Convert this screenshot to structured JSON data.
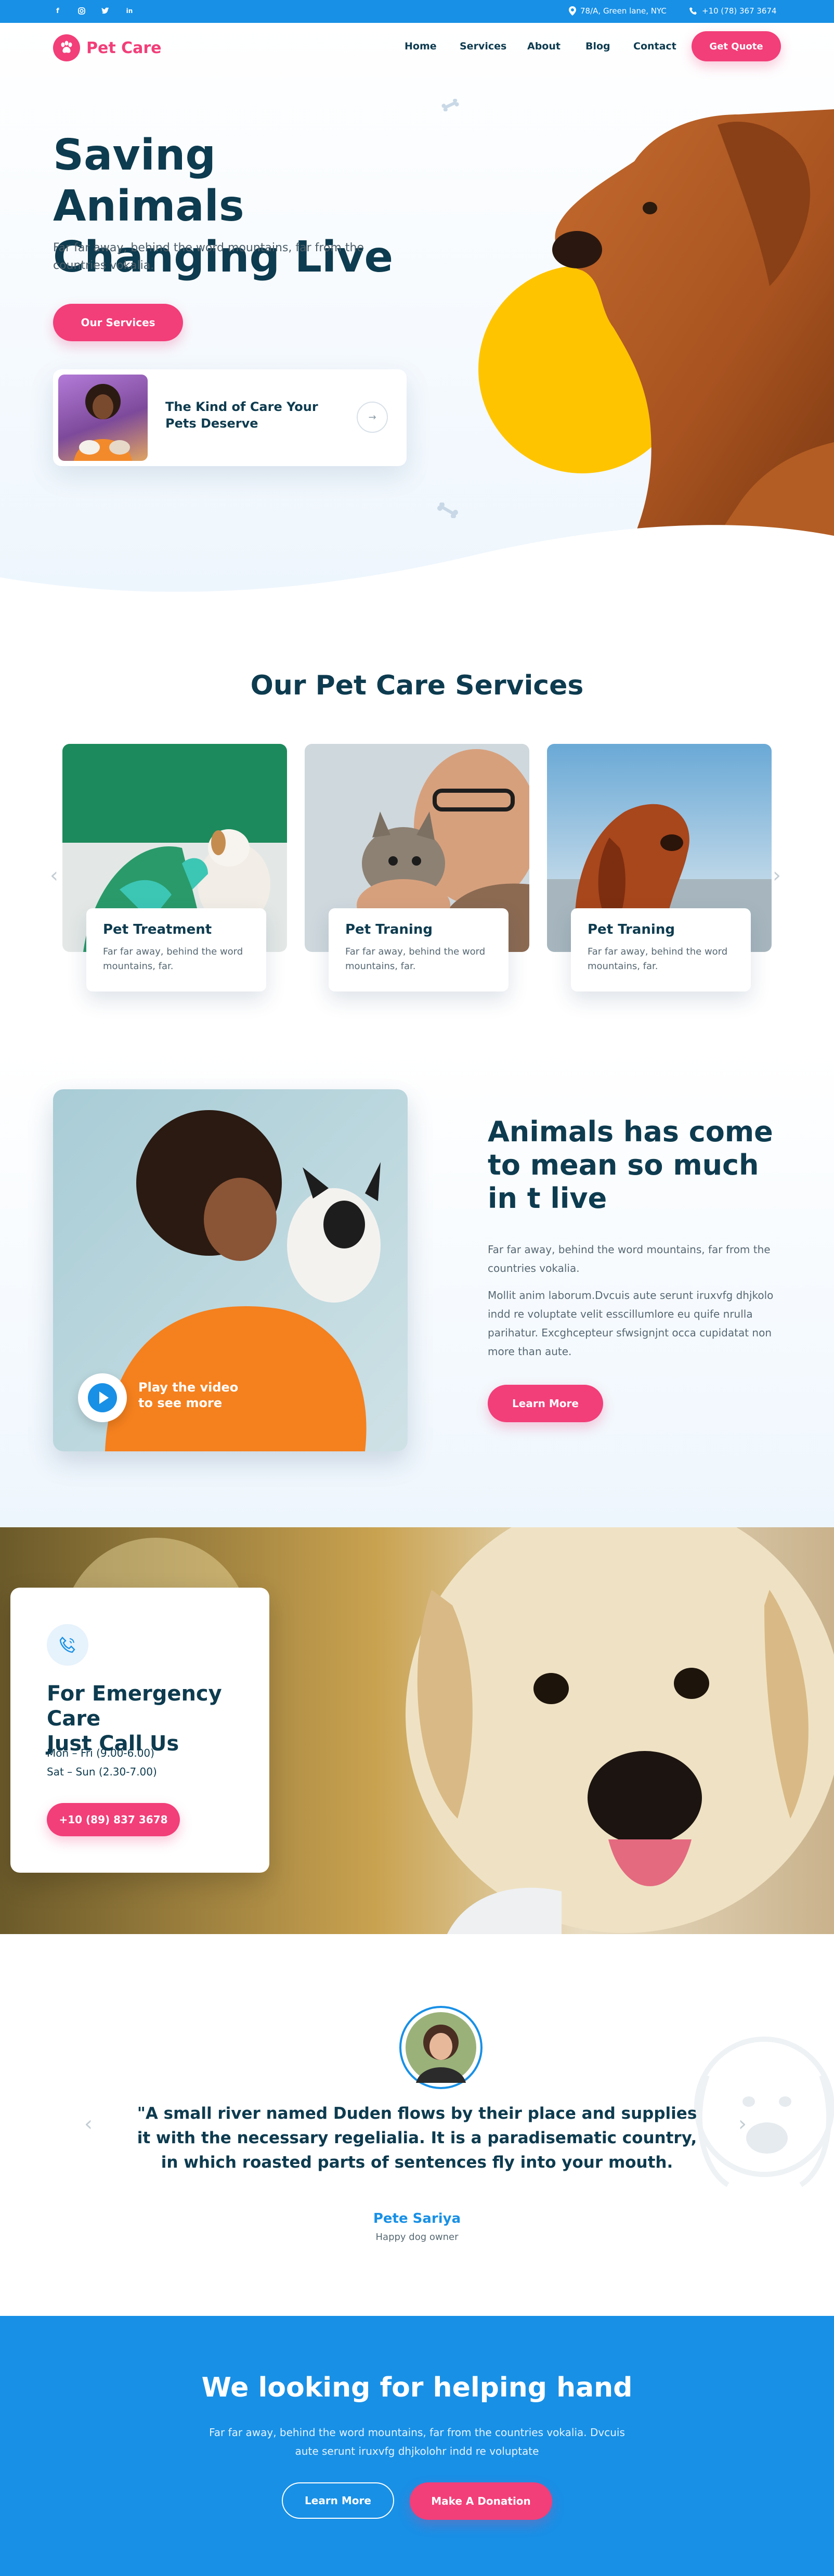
{
  "topbar": {
    "address": "78/A, Green lane, NYC",
    "phone": "+10 (78) 367 3674"
  },
  "brand": {
    "name": "Pet Care"
  },
  "nav": {
    "items": [
      "Home",
      "Services",
      "About",
      "Blog",
      "Contact"
    ],
    "cta": "Get Quote"
  },
  "hero": {
    "title_line1": "Saving Animals",
    "title_line2": "Changing Live",
    "subtitle": "Far far away, behind the word mountains, far from the countries vokalia.",
    "button": "Our Services",
    "card_title": "The Kind of Care Your Pets Deserve"
  },
  "services": {
    "title": "Our Pet Care Services",
    "items": [
      {
        "title": "Pet Treatment",
        "desc": "Far far away, behind the word mountains, far."
      },
      {
        "title": "Pet Traning",
        "desc": "Far far away, behind the word mountains, far."
      },
      {
        "title": "Pet Traning",
        "desc": "Far far away, behind the word mountains, far."
      }
    ]
  },
  "about": {
    "title_line1": "Animals has come",
    "title_line2": "to mean so much",
    "title_line3": "in t live",
    "p1": "Far far away, behind the word mountains, far from the countries vokalia.",
    "p2": "Mollit anim laborum.Dvcuis aute serunt iruxvfg dhjkolo indd re voluptate velit esscillumlore eu quife nrulla parihatur. Excghcepteur sfwsignjnt occa cupidatat non more than aute.",
    "button": "Learn More",
    "video_label_line1": "Play the video",
    "video_label_line2": "to see more"
  },
  "emergency": {
    "title_line1": "For Emergency Care",
    "title_line2": "Just Call Us",
    "hours1": "Mon – Fri (9.00-6.00)",
    "hours2": "Sat – Sun (2.30-7.00)",
    "phone": "+10 (89) 837 3678"
  },
  "testimonial": {
    "quote": "\"A small river named Duden flows by their place and supplies it with the necessary regelialia. It is a paradisematic country, in which roasted parts of sentences fly into your mouth.",
    "name": "Pete Sariya",
    "role": "Happy dog owner"
  },
  "cta": {
    "title": "We looking for helping hand",
    "text_line1": "Far far away, behind the word mountains, far from the countries vokalia. Dvcuis",
    "text_line2": "aute serunt iruxvfg dhjkolohr indd re voluptate",
    "button1": "Learn More",
    "button2": "Make A Donation"
  },
  "colors": {
    "primary_blue": "#1890e6",
    "accent_pink": "#f23e79",
    "navy": "#0d3b4f",
    "yellow": "#ffc400"
  },
  "icons": [
    "facebook-icon",
    "instagram-icon",
    "twitter-icon",
    "linkedin-icon",
    "map-pin-icon",
    "phone-icon",
    "paw-icon",
    "arrow-icon",
    "chevron-left-icon",
    "chevron-right-icon",
    "play-icon",
    "phone-call-icon"
  ]
}
